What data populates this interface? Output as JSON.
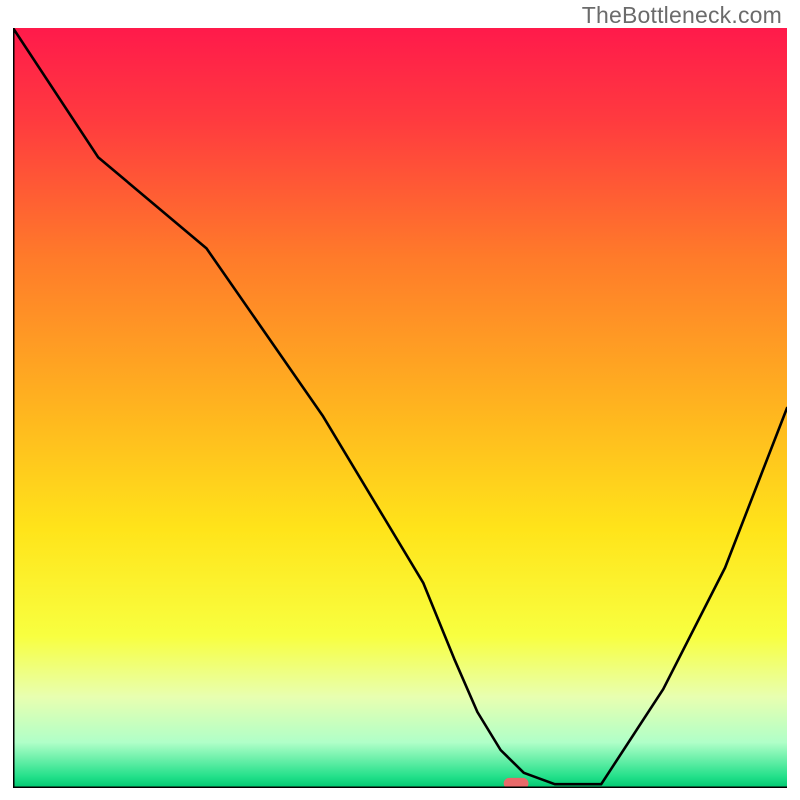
{
  "watermark": "TheBottleneck.com",
  "chart_data": {
    "type": "line",
    "title": "",
    "xlabel": "",
    "ylabel": "",
    "xlim": [
      0,
      100
    ],
    "ylim": [
      0,
      100
    ],
    "grid": false,
    "legend": false,
    "gradient_stops": [
      {
        "offset": 0.0,
        "color": "#ff1a4b"
      },
      {
        "offset": 0.12,
        "color": "#ff3a3f"
      },
      {
        "offset": 0.3,
        "color": "#ff7a2a"
      },
      {
        "offset": 0.5,
        "color": "#ffb41f"
      },
      {
        "offset": 0.66,
        "color": "#ffe41a"
      },
      {
        "offset": 0.8,
        "color": "#f8ff40"
      },
      {
        "offset": 0.88,
        "color": "#e8ffb0"
      },
      {
        "offset": 0.94,
        "color": "#b0ffc8"
      },
      {
        "offset": 0.985,
        "color": "#23e08a"
      },
      {
        "offset": 1.0,
        "color": "#00c770"
      }
    ],
    "series": [
      {
        "name": "bottleneck-curve",
        "x": [
          0,
          11,
          25,
          40,
          53,
          57,
          60,
          63,
          66,
          70,
          76,
          84,
          92,
          100
        ],
        "y": [
          100,
          83,
          71,
          49,
          27,
          17,
          10,
          5,
          2,
          0.5,
          0.5,
          13,
          29,
          50
        ]
      }
    ],
    "marker": {
      "name": "optimal-marker",
      "x_center": 65,
      "y": 0.6,
      "width_pct": 3.2,
      "color": "#e86a6a"
    },
    "frame": {
      "left": true,
      "bottom": true,
      "top": false,
      "right": false,
      "color": "#000000",
      "width": 2
    }
  }
}
